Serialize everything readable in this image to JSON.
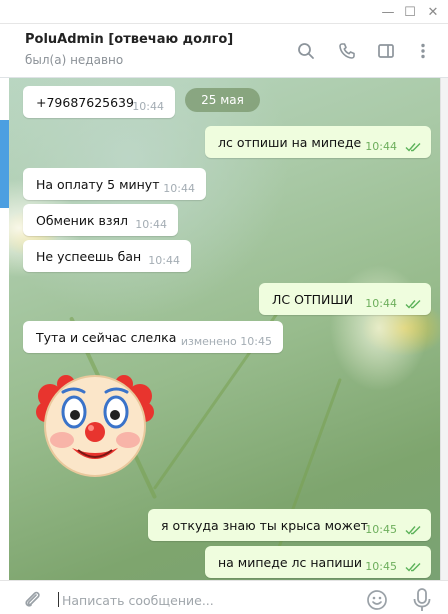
{
  "window": {
    "minimize_glyph": "—",
    "maximize_glyph": "☐",
    "close_glyph": "✕"
  },
  "header": {
    "chat_name": "PoluAdmin [отвечаю долго]",
    "status": "был(а) недавно",
    "icons": [
      "search-icon",
      "phone-icon",
      "sidebar-toggle-icon",
      "more-vertical-icon"
    ]
  },
  "date_separator": "25 мая",
  "messages": [
    {
      "direction": "in",
      "text": "+79687625639",
      "time": "10:44"
    },
    {
      "direction": "out",
      "text": "лс отпиши на мипеде",
      "time": "10:44",
      "read": true
    },
    {
      "direction": "in",
      "text": "На оплату 5 минут",
      "time": "10:44"
    },
    {
      "direction": "in",
      "text": "Обменик взял",
      "time": "10:44"
    },
    {
      "direction": "in",
      "text": "Не успеешь бан",
      "time": "10:44"
    },
    {
      "direction": "out",
      "text": "ЛС ОТПИШИ",
      "time": "10:44",
      "read": true
    },
    {
      "direction": "in",
      "text": "Тута и сейчас слелка",
      "time": "изменено 10:45"
    },
    {
      "direction": "out",
      "text": "я откуда знаю ты крыса может",
      "time": "10:45",
      "read": true
    },
    {
      "direction": "out",
      "text": "на мипеде лс напиши",
      "time": "10:45",
      "read": true
    }
  ],
  "sticker": {
    "icon": "clown-face-sticker"
  },
  "composer": {
    "placeholder": "Написать сообщение...",
    "value": "",
    "icons": [
      "paperclip-icon",
      "emoji-icon",
      "microphone-icon"
    ]
  },
  "colors": {
    "incoming_bubble": "#ffffff",
    "outgoing_bubble": "#effdde",
    "read_ticks": "#5cb25a",
    "sidebar_accent": "#4c9fe1"
  }
}
